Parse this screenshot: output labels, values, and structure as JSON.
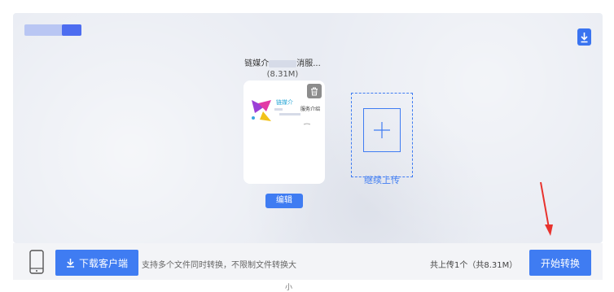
{
  "file": {
    "name_prefix": "链媒介",
    "name_suffix": "消服...",
    "size": "(8.31M)",
    "thumbnail_text_1": "链媒介",
    "thumbnail_text_2": "服务介绍"
  },
  "actions": {
    "edit_label": "编辑",
    "continue_upload_label": "继续上传"
  },
  "bottom_bar": {
    "download_client_label": "下载客户端",
    "support_text": "支持多个文件同时转换，不限制文件转换大",
    "total_text": "共上传1个（共8.31M）",
    "start_label": "开始转换"
  },
  "footer": {
    "small_text": "小"
  },
  "colors": {
    "accent": "#3f7cf2",
    "arrow": "#e8322d",
    "panel_bg": "#e9ecf3"
  }
}
